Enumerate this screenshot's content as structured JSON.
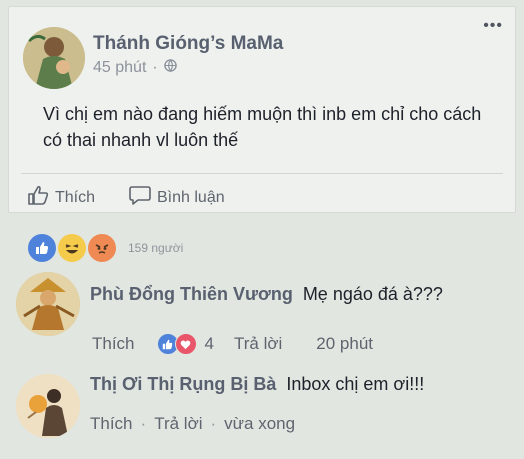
{
  "post": {
    "author": "Thánh Gióng’s MaMa",
    "time": "45 phút",
    "more": "•••",
    "text": "Vì chị em nào đang hiếm muộn thì inb em chỉ cho cách có thai nhanh vl luôn thế",
    "like_label": "Thích",
    "comment_label": "Bình luận"
  },
  "reactions": {
    "count_text": "159 người",
    "icons": [
      "like-icon",
      "haha-icon",
      "angry-icon"
    ]
  },
  "comments": [
    {
      "name": "Phù Đổng Thiên Vương",
      "text": "Mẹ ngáo đá à???",
      "like_label": "Thích",
      "reaction_count": "4",
      "reply_label": "Trả lời",
      "time": "20 phút"
    },
    {
      "name": "Thị Ơi Thị Rụng Bị Bà",
      "text": "Inbox chị em ơi!!!",
      "like_label": "Thích",
      "reply_label": "Trả lời",
      "time": "vừa xong"
    }
  ],
  "colors": {
    "background": "#e2e6e1",
    "card": "#eef1ee",
    "name": "#59606f",
    "like_blue": "#4f83db",
    "love_red": "#e9566a",
    "haha_yellow": "#f5cb4b",
    "angry_orange": "#ef8a55"
  }
}
